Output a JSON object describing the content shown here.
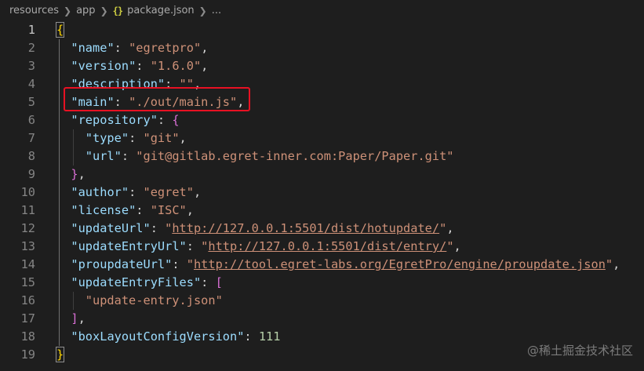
{
  "breadcrumb": {
    "items": [
      "resources",
      "app",
      "package.json",
      "..."
    ],
    "file_icon": "{}"
  },
  "editor": {
    "line_numbers": [
      "1",
      "2",
      "3",
      "4",
      "5",
      "6",
      "7",
      "8",
      "9",
      "10",
      "11",
      "12",
      "13",
      "14",
      "15",
      "16",
      "17",
      "18",
      "19"
    ],
    "lines": [
      [
        [
          "b1",
          "{"
        ]
      ],
      [
        [
          "k",
          "\"name\""
        ],
        [
          "p",
          ": "
        ],
        [
          "s",
          "\"egretpro\""
        ],
        [
          "p",
          ","
        ]
      ],
      [
        [
          "k",
          "\"version\""
        ],
        [
          "p",
          ": "
        ],
        [
          "s",
          "\"1.6.0\""
        ],
        [
          "p",
          ","
        ]
      ],
      [
        [
          "k",
          "\"description\""
        ],
        [
          "p",
          ": "
        ],
        [
          "s",
          "\"\""
        ],
        [
          "p",
          ","
        ]
      ],
      [
        [
          "k",
          "\"main\""
        ],
        [
          "p",
          ": "
        ],
        [
          "s",
          "\"./out/main.js\""
        ],
        [
          "p",
          ","
        ]
      ],
      [
        [
          "k",
          "\"repository\""
        ],
        [
          "p",
          ": "
        ],
        [
          "b2",
          "{"
        ]
      ],
      [
        [
          "k",
          "\"type\""
        ],
        [
          "p",
          ": "
        ],
        [
          "s",
          "\"git\""
        ],
        [
          "p",
          ","
        ]
      ],
      [
        [
          "k",
          "\"url\""
        ],
        [
          "p",
          ": "
        ],
        [
          "s",
          "\"git@gitlab.egret-inner.com:Paper/Paper.git\""
        ]
      ],
      [
        [
          "b2",
          "}"
        ],
        [
          "p",
          ","
        ]
      ],
      [
        [
          "k",
          "\"author\""
        ],
        [
          "p",
          ": "
        ],
        [
          "s",
          "\"egret\""
        ],
        [
          "p",
          ","
        ]
      ],
      [
        [
          "k",
          "\"license\""
        ],
        [
          "p",
          ": "
        ],
        [
          "s",
          "\"ISC\""
        ],
        [
          "p",
          ","
        ]
      ],
      [
        [
          "k",
          "\"updateUrl\""
        ],
        [
          "p",
          ": "
        ],
        [
          "s",
          "\""
        ],
        [
          "u",
          "http://127.0.0.1:5501/dist/hotupdate/"
        ],
        [
          "s",
          "\""
        ],
        [
          "p",
          ","
        ]
      ],
      [
        [
          "k",
          "\"updateEntryUrl\""
        ],
        [
          "p",
          ": "
        ],
        [
          "s",
          "\""
        ],
        [
          "u",
          "http://127.0.0.1:5501/dist/entry/"
        ],
        [
          "s",
          "\""
        ],
        [
          "p",
          ","
        ]
      ],
      [
        [
          "k",
          "\"proupdateUrl\""
        ],
        [
          "p",
          ": "
        ],
        [
          "s",
          "\""
        ],
        [
          "u",
          "http://tool.egret-labs.org/EgretPro/engine/proupdate.json"
        ],
        [
          "s",
          "\""
        ],
        [
          "p",
          ","
        ]
      ],
      [
        [
          "k",
          "\"updateEntryFiles\""
        ],
        [
          "p",
          ": "
        ],
        [
          "b2",
          "["
        ]
      ],
      [
        [
          "s",
          "\"update-entry.json\""
        ]
      ],
      [
        [
          "b2",
          "]"
        ],
        [
          "p",
          ","
        ]
      ],
      [
        [
          "k",
          "\"boxLayoutConfigVersion\""
        ],
        [
          "p",
          ": "
        ],
        [
          "n",
          "111"
        ]
      ],
      [
        [
          "b1",
          "}"
        ]
      ]
    ],
    "indents": [
      0,
      1,
      1,
      1,
      1,
      1,
      2,
      2,
      1,
      1,
      1,
      1,
      1,
      1,
      1,
      2,
      1,
      1,
      0
    ],
    "active_line": 1,
    "highlighted_line": 5
  },
  "watermark": "@稀土掘金技术社区",
  "colors": {
    "background": "#1e1e1e",
    "key": "#9cdcfe",
    "string": "#ce9178",
    "number": "#b5cea8",
    "bracket_level1": "#ffd700",
    "bracket_level2": "#da70d6",
    "highlight_border": "#e81123"
  }
}
